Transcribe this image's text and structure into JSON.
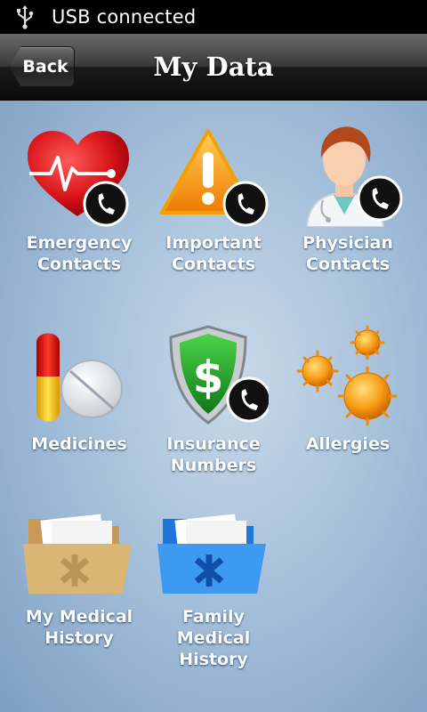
{
  "status_bar": {
    "usb_text": "USB connected",
    "icon": "usb-icon"
  },
  "header": {
    "back_label": "Back",
    "title": "My Data"
  },
  "tiles": [
    {
      "label": "Emergency\nContacts",
      "icon": "heart-phone-icon"
    },
    {
      "label": "Important\nContacts",
      "icon": "warning-phone-icon"
    },
    {
      "label": "Physician\nContacts",
      "icon": "doctor-phone-icon"
    },
    {
      "label": "Medicines",
      "icon": "pill-icon"
    },
    {
      "label": "Insurance\nNumbers",
      "icon": "shield-dollar-icon"
    },
    {
      "label": "Allergies",
      "icon": "pollen-icon"
    },
    {
      "label": "My Medical\nHistory",
      "icon": "folder-tan-icon"
    },
    {
      "label": "Family\nMedical\nHistory",
      "icon": "folder-blue-icon"
    }
  ]
}
